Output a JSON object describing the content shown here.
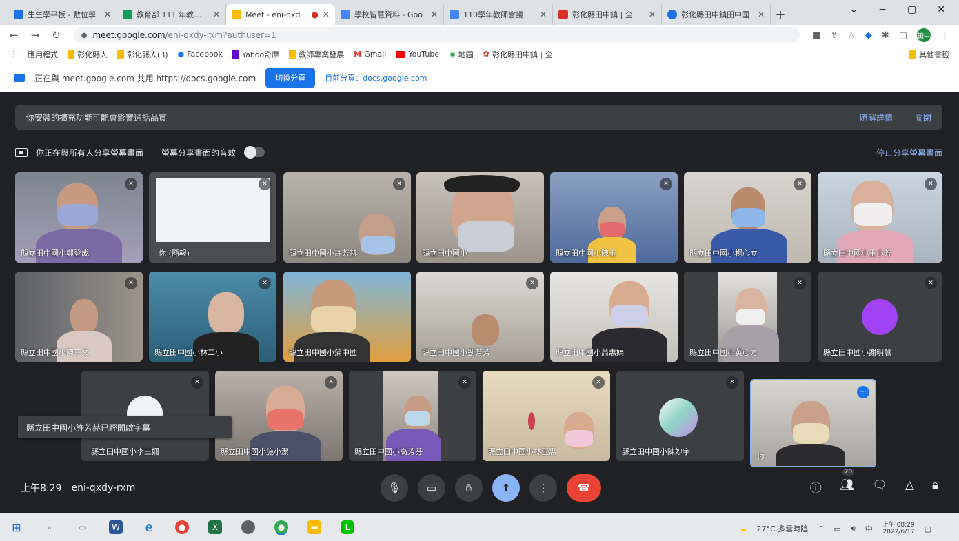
{
  "browser": {
    "tabs": [
      {
        "title": "生生學平板 - 數位學",
        "color": "#1a73e8"
      },
      {
        "title": "教育部 111 年教育部",
        "color": "#0f9d58"
      },
      {
        "title": "Meet - eni-qxd",
        "color": "#fbbc04",
        "active": true
      },
      {
        "title": "學校智慧資料 - Goo",
        "color": "#4285f4"
      },
      {
        "title": "110學年教師會議",
        "color": "#4285f4"
      },
      {
        "title": "彰化縣田中鎮 | 全",
        "color": "#d93025"
      },
      {
        "title": "彰化縣田中鎮田中國",
        "color": "#1a73e8"
      }
    ],
    "new_tab": "+",
    "window_controls": [
      "⌄",
      "−",
      "▢",
      "✕"
    ],
    "url_host": "meet.google.com",
    "url_path": "/eni-qxdy-rxm?authuser=1",
    "profile_initial": "田中",
    "bookmarks": [
      "應用程式",
      "彰化縣人",
      "彰化縣人(3)",
      "Facebook",
      "Yahoo奇摩",
      "教師專業發展",
      "Gmail",
      "YouTube",
      "地圖",
      "彰化縣田中鎮 | 全"
    ],
    "bookmarks_other": "其他書籤",
    "share_message": "正在與 meet.google.com 共用 https://docs.google.com",
    "share_switch_button": "切換分頁",
    "share_source": "目前分頁：docs.google.com"
  },
  "meet": {
    "notice_text": "你安裝的擴充功能可能會影響通話品質",
    "notice_more": "瞭解詳情",
    "notice_close": "關閉",
    "presenting_text": "你正在與所有人分享螢幕畫面",
    "share_audio_label": "螢幕分享畫面的音效",
    "stop_sharing": "停止分享螢幕畫面",
    "participants": [
      {
        "name": "縣立田中國小鄭登成"
      },
      {
        "name": "你 (簡報)"
      },
      {
        "name": "縣立田中國小許芳赫"
      },
      {
        "name": "縣立田中國小"
      },
      {
        "name": "縣立田中國小陳玉"
      },
      {
        "name": "縣立田中國小楊心立"
      },
      {
        "name": "縣立田中國小王小芳"
      },
      {
        "name": "縣立田中國小陳三文"
      },
      {
        "name": "縣立田中國小林二小"
      },
      {
        "name": "縣立田中國小蒲中國"
      },
      {
        "name": "縣立田中國小劉芳芳"
      },
      {
        "name": "縣立田中國小蕭惠娟"
      },
      {
        "name": "縣立田中國小黃心方"
      },
      {
        "name": "縣立田中國小謝明慧"
      },
      {
        "name": "縣立田中國小李三姍"
      },
      {
        "name": "縣立田中國小施小潔"
      },
      {
        "name": "縣立田中國小高芳芬"
      },
      {
        "name": "縣立田中國小林玉惠"
      },
      {
        "name": "縣立田中國小陳妙宇"
      },
      {
        "name": "你"
      }
    ],
    "popup_name": "縣立田中國小許芳赫已經開啟字幕",
    "clock": "上午8:29",
    "meeting_code": "eni-qxdy-rxm",
    "participant_count": "20"
  },
  "taskbar": {
    "weather": "27°C 多雲時陰",
    "ime": "中",
    "time": "上午 08:29",
    "date": "2022/6/17"
  }
}
